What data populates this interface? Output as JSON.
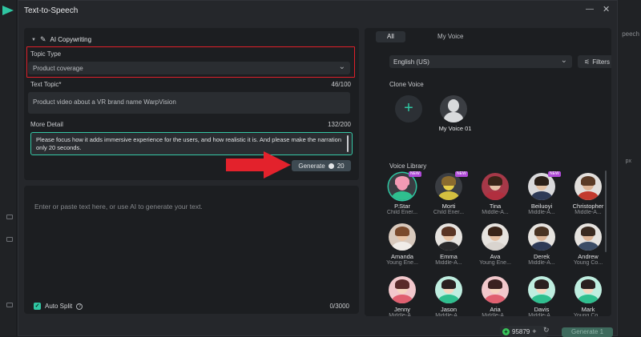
{
  "window": {
    "title": "Text-to-Speech",
    "minimize_icon": "minimize-icon",
    "close_icon": "close-icon"
  },
  "background": {
    "right_label": "peech",
    "px_label": "px"
  },
  "copywriting": {
    "section_label": "AI Copywriting",
    "topic_type_label": "Topic Type",
    "topic_type_value": "Product coverage",
    "text_topic_label": "Text Topic*",
    "text_topic_count": "46/100",
    "text_topic_value": "Product video about a VR brand name WarpVision",
    "more_detail_label": "More Detail",
    "more_detail_count": "132/200",
    "more_detail_value": "Please focus how it adds immersive experience for the users, and how realistic it is. And please make the narration only 20 seconds.",
    "generate_label": "Generate",
    "generate_cost": "20"
  },
  "editor": {
    "placeholder": "Enter or paste text here, or use AI to generate your text.",
    "auto_split_label": "Auto Split",
    "auto_split_checked": true,
    "char_count": "0/3000"
  },
  "voices": {
    "tabs": [
      {
        "label": "All",
        "active": true
      },
      {
        "label": "My Voice",
        "active": false
      }
    ],
    "language": "English (US)",
    "filters_label": "Filters",
    "clone_label": "Clone Voice",
    "my_voice_name": "My Voice 01",
    "library_label": "Voice Library",
    "library": [
      {
        "name": "P.Star",
        "desc": "Child Ener...",
        "new": true,
        "selected": true,
        "colors": {
          "bg": "#3a3d42",
          "head": "#f39ab4",
          "hair": "#f39ab4",
          "body": "#2fbf8f"
        }
      },
      {
        "name": "Morti",
        "desc": "Child Ener...",
        "new": true,
        "selected": false,
        "colors": {
          "bg": "#3a3d42",
          "head": "#e8d049",
          "hair": "#8a6b2f",
          "body": "#d4c040"
        }
      },
      {
        "name": "Tina",
        "desc": "Middle-A...",
        "new": false,
        "selected": false,
        "colors": {
          "bg": "#a63848",
          "head": "#e8c2a8",
          "hair": "#3a2418",
          "body": "#b12f3f"
        }
      },
      {
        "name": "Beiluoyi",
        "desc": "Middle-A...",
        "new": true,
        "selected": false,
        "colors": {
          "bg": "#d9d9db",
          "head": "#e3c1a3",
          "hair": "#2b2018",
          "body": "#2e3a56"
        }
      },
      {
        "name": "Christopher",
        "desc": "Middle-A...",
        "new": false,
        "selected": false,
        "colors": {
          "bg": "#e2dfdc",
          "head": "#dcb496",
          "hair": "#5b3b26",
          "body": "#c23a2e"
        }
      },
      {
        "name": "Amanda",
        "desc": "Young Ene...",
        "new": false,
        "selected": false,
        "colors": {
          "bg": "#d8c9bd",
          "head": "#e8c4a6",
          "hair": "#7a4a2c",
          "body": "#f0ece8"
        }
      },
      {
        "name": "Emma",
        "desc": "Middle-A...",
        "new": false,
        "selected": false,
        "colors": {
          "bg": "#e6e3df",
          "head": "#e8c4a6",
          "hair": "#5a3524",
          "body": "#2a2a2c"
        }
      },
      {
        "name": "Ava",
        "desc": "Young Ene...",
        "new": false,
        "selected": false,
        "colors": {
          "bg": "#e6e3df",
          "head": "#e6c0a2",
          "hair": "#3a2418",
          "body": "#d9d4cf"
        }
      },
      {
        "name": "Derek",
        "desc": "Middle-A...",
        "new": false,
        "selected": false,
        "colors": {
          "bg": "#e6e3df",
          "head": "#dcb496",
          "hair": "#4a3322",
          "body": "#2e3a56"
        }
      },
      {
        "name": "Andrew",
        "desc": "Young Co...",
        "new": false,
        "selected": false,
        "colors": {
          "bg": "#e6e3df",
          "head": "#dcb496",
          "hair": "#3a2a20",
          "body": "#3c4d66"
        }
      },
      {
        "name": "Jenny",
        "desc": "Middle-A...",
        "new": false,
        "selected": false,
        "colors": {
          "bg": "#f2c8cc",
          "head": "#f5d6c0",
          "hair": "#5a2a2a",
          "body": "#e06070"
        }
      },
      {
        "name": "Jason",
        "desc": "Middle-A...",
        "new": false,
        "selected": false,
        "colors": {
          "bg": "#bfeee0",
          "head": "#f5d6c0",
          "hair": "#2a2020",
          "body": "#2fbf8f"
        }
      },
      {
        "name": "Aria",
        "desc": "Middle-A...",
        "new": false,
        "selected": false,
        "colors": {
          "bg": "#f2c8cc",
          "head": "#f5d6c0",
          "hair": "#3a2020",
          "body": "#e06070"
        }
      },
      {
        "name": "Davis",
        "desc": "Middle-A...",
        "new": false,
        "selected": false,
        "colors": {
          "bg": "#bfeee0",
          "head": "#f5d6c0",
          "hair": "#2a2020",
          "body": "#2fbf8f"
        }
      },
      {
        "name": "Mark",
        "desc": "Young Co...",
        "new": false,
        "selected": false,
        "colors": {
          "bg": "#bfeee0",
          "head": "#f5d6c0",
          "hair": "#2a2020",
          "body": "#2fbf8f"
        }
      }
    ]
  },
  "footer": {
    "credits": "95879",
    "generate_label": "Generate",
    "generate_cost": "1"
  },
  "colors": {
    "accent": "#2fc6a2",
    "highlight_red": "#e0202a",
    "panel": "#1c1e21",
    "window": "#25272b"
  }
}
